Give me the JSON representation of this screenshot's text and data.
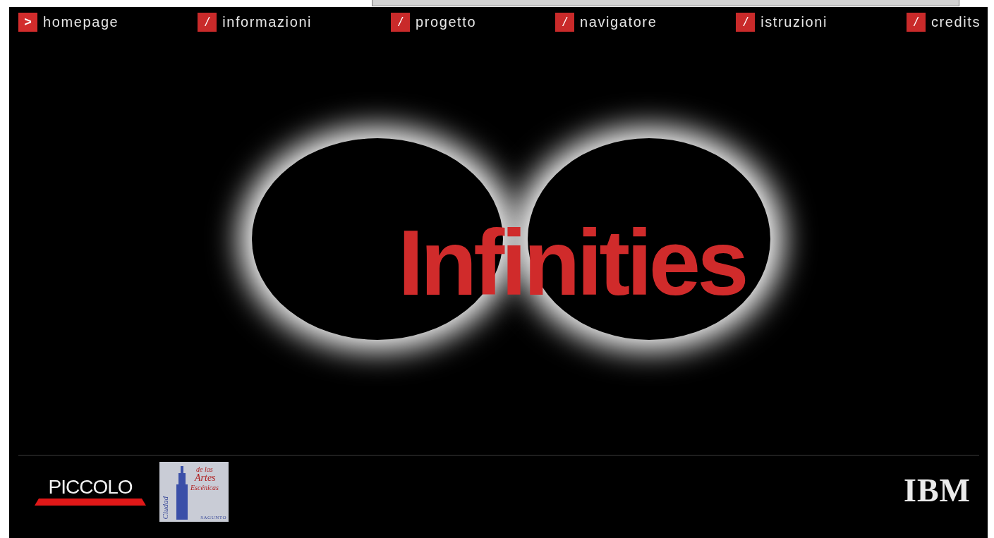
{
  "nav": [
    {
      "marker": ">",
      "label": "homepage",
      "selected": true
    },
    {
      "marker": "/",
      "label": "informazioni",
      "selected": false
    },
    {
      "marker": "/",
      "label": "progetto",
      "selected": false
    },
    {
      "marker": "/",
      "label": "navigatore",
      "selected": false
    },
    {
      "marker": "/",
      "label": "istruzioni",
      "selected": false
    },
    {
      "marker": "/",
      "label": "credits",
      "selected": false
    }
  ],
  "hero": {
    "title": "Infinities"
  },
  "footer": {
    "logos": [
      {
        "kind": "piccolo",
        "text": "PICCOLO"
      },
      {
        "kind": "ciudad",
        "top": "de las",
        "main": "Artes",
        "sub": "Escénicas",
        "side": "Ciudad",
        "bottom": "SAGUNTO"
      },
      {
        "kind": "ibm",
        "text": "IBM"
      }
    ]
  }
}
